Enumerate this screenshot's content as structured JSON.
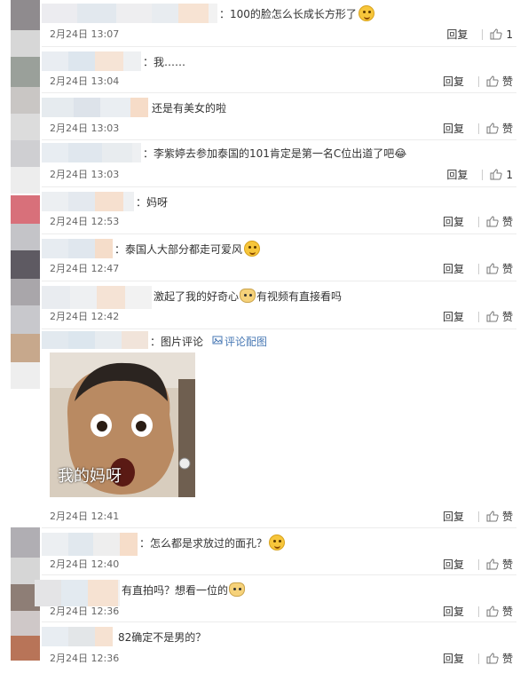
{
  "comments": [
    {
      "text": "：100的脸怎么长成长方形了",
      "date": "2月24日 13:07",
      "reply": "回复",
      "like": "1",
      "emoji": "grin-emoji"
    },
    {
      "text": "：我……",
      "date": "2月24日 13:04",
      "reply": "回复",
      "like": "赞"
    },
    {
      "text": "还是有美女的啦",
      "date": "2月24日 13:03",
      "reply": "回复",
      "like": "赞"
    },
    {
      "text": "：李紫婷去参加泰国的101肯定是第一名C位出道了吧😂",
      "date": "2月24日 13:03",
      "reply": "回复",
      "like": "1"
    },
    {
      "text": "：妈呀",
      "date": "2月24日 12:53",
      "reply": "回复",
      "like": "赞"
    },
    {
      "text": "：泰国人大部分都走可爱风",
      "date": "2月24日 12:47",
      "reply": "回复",
      "like": "赞",
      "emoji": "grin-emoji"
    },
    {
      "text_a": "激起了我的好奇心",
      "text_b": "有视频有直接看吗",
      "date": "2月24日 12:42",
      "reply": "回复",
      "like": "赞"
    },
    {
      "text": "：图片评论",
      "link": "评论配图",
      "caption": "我的妈呀",
      "date": "2月24日 12:41",
      "reply": "回复",
      "like": "赞"
    },
    {
      "text": "：怎么都是求放过的面孔？",
      "date": "2月24日 12:40",
      "reply": "回复",
      "like": "赞",
      "emoji": "grin-emoji"
    },
    {
      "text": "有直拍吗？想看一位的",
      "date": "2月24日 12:36",
      "reply": "回复",
      "like": "赞"
    },
    {
      "text": "82确定不是男的？",
      "date": "2月24日 12:36",
      "reply": "回复",
      "like": "赞"
    }
  ]
}
